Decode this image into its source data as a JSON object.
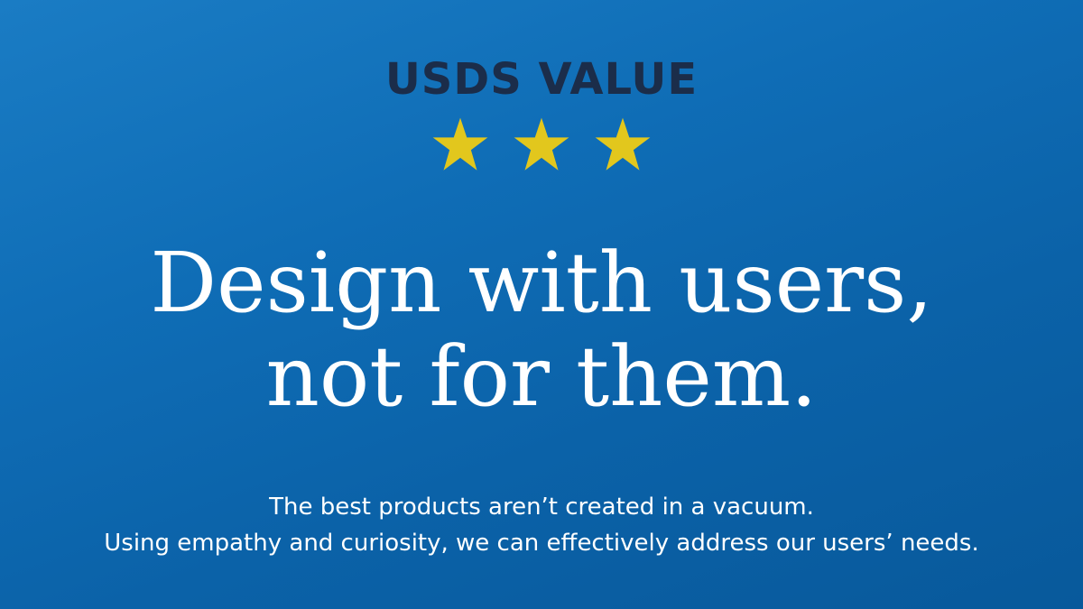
{
  "eyebrow": "USDS VALUE",
  "stars": {
    "count": 3,
    "icon": "star-icon",
    "color": "#e2c71d"
  },
  "headline": {
    "line1": "Design with users,",
    "line2": "not for them."
  },
  "body": {
    "line1": "The best products aren’t created in a vacuum.",
    "line2": "Using empathy and curiosity, we can effectively address our users’ needs."
  },
  "colors": {
    "background": "#0f6db6",
    "eyebrow": "#1b2d4a",
    "text": "#ffffff"
  }
}
